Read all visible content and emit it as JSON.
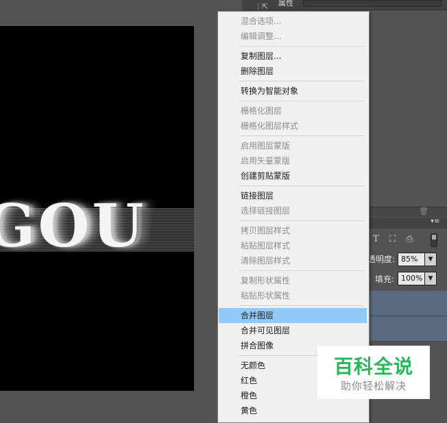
{
  "canvas": {
    "art_text": "GOU"
  },
  "properties_panel": {
    "tab_label": "属性"
  },
  "layers_panel": {
    "opacity_label": "透明度:",
    "opacity_value": "85%",
    "fill_label": "填充:",
    "fill_value": "100%",
    "filter_icons": [
      "T",
      "⛶",
      "⎙"
    ]
  },
  "context_menu": {
    "items": [
      {
        "label": "混合选项...",
        "enabled": false
      },
      {
        "label": "编辑调整...",
        "enabled": false
      },
      {
        "label": "复制图层...",
        "enabled": true
      },
      {
        "label": "删除图层",
        "enabled": true
      },
      {
        "label": "转换为智能对象",
        "enabled": true
      },
      {
        "label": "栅格化图层",
        "enabled": false
      },
      {
        "label": "栅格化图层样式",
        "enabled": false
      },
      {
        "label": "启用图层蒙版",
        "enabled": false
      },
      {
        "label": "启用矢量蒙版",
        "enabled": false
      },
      {
        "label": "创建剪贴蒙版",
        "enabled": true
      },
      {
        "label": "链接图层",
        "enabled": true
      },
      {
        "label": "选择链接图层",
        "enabled": false
      },
      {
        "label": "拷贝图层样式",
        "enabled": false
      },
      {
        "label": "粘贴图层样式",
        "enabled": false
      },
      {
        "label": "清除图层样式",
        "enabled": false
      },
      {
        "label": "复制形状属性",
        "enabled": false
      },
      {
        "label": "粘贴形状属性",
        "enabled": false
      },
      {
        "label": "合并图层",
        "enabled": true,
        "highlighted": true
      },
      {
        "label": "合并可见图层",
        "enabled": true
      },
      {
        "label": "拼合图像",
        "enabled": true
      },
      {
        "label": "无颜色",
        "enabled": true
      },
      {
        "label": "红色",
        "enabled": true
      },
      {
        "label": "橙色",
        "enabled": true
      },
      {
        "label": "黄色",
        "enabled": true
      }
    ]
  },
  "watermark": {
    "title": "百科全说",
    "subtitle": "助你轻松解决"
  },
  "colors": {
    "menu_highlight": "#91c9f7",
    "watermark_green": "#2bb55a",
    "panel_bg": "#535353",
    "layer_selected": "#5c6a80"
  }
}
